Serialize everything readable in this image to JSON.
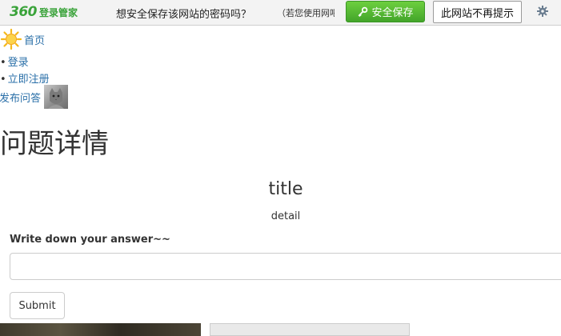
{
  "pwbar": {
    "logo_number": "360",
    "logo_text": "登录管家",
    "question": "想安全保存该网站的密码吗？",
    "hint": "（若您使用网吧",
    "save_label": "安全保存",
    "never_label": "此网站不再提示"
  },
  "nav": {
    "home": "首页",
    "items": [
      {
        "label": "登录"
      },
      {
        "label": "立即注册"
      }
    ],
    "post": "发布问答"
  },
  "page": {
    "title": "问题详情",
    "question_title": "title",
    "question_detail": "detail",
    "answer_label": "Write down your answer~~",
    "answer_value": "",
    "submit_label": "Submit"
  }
}
